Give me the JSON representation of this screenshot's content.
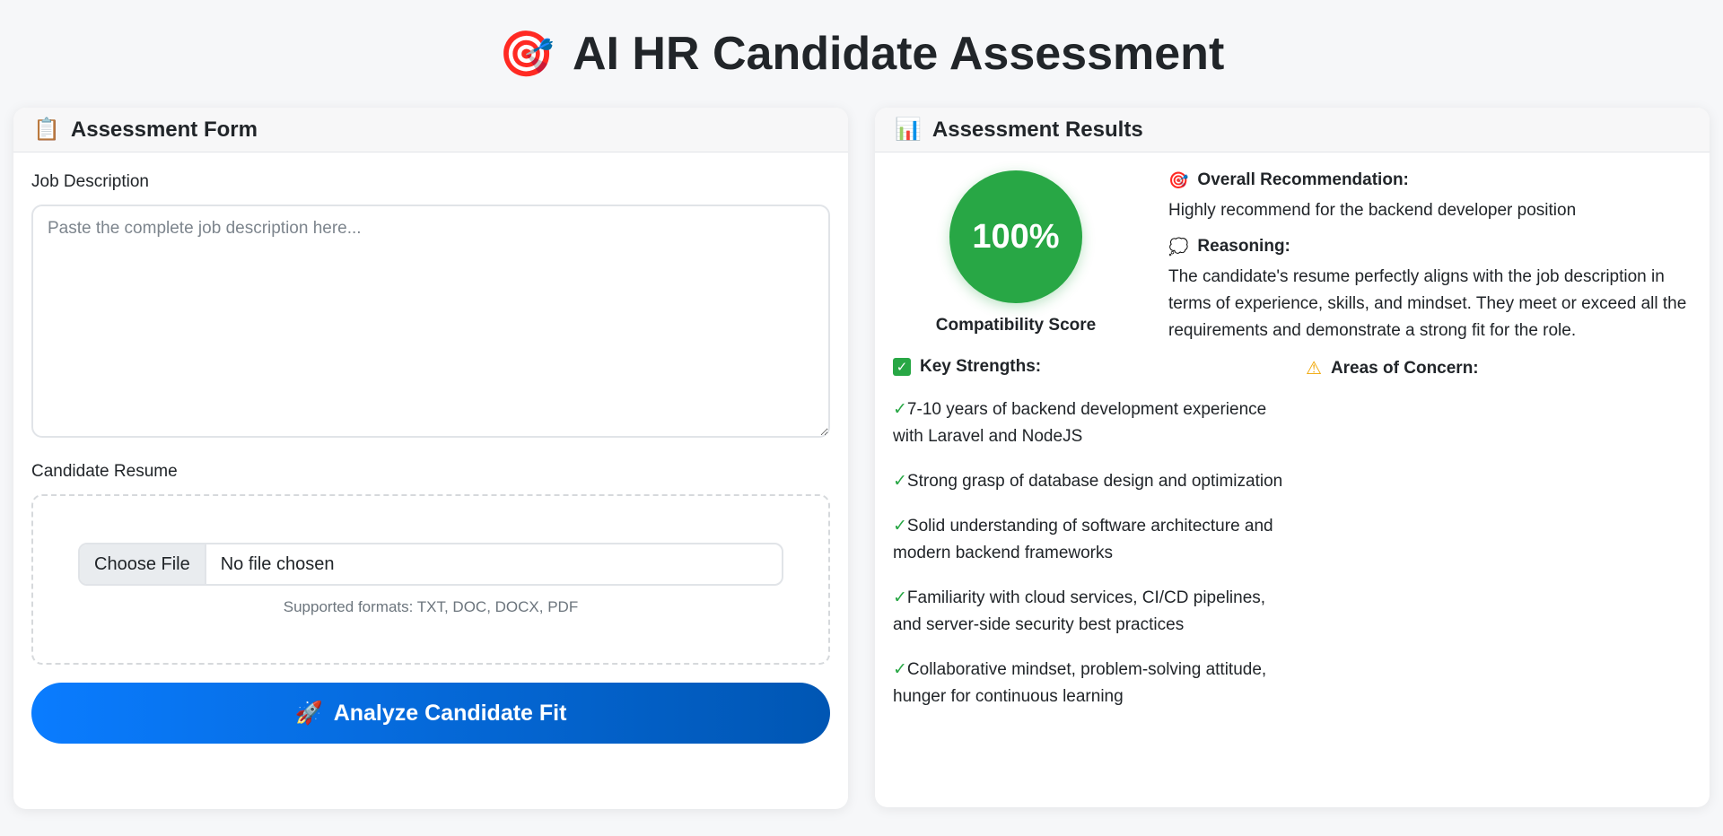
{
  "header": {
    "icon": "target-icon",
    "title": "AI HR Candidate Assessment"
  },
  "form": {
    "header_icon": "clipboard-icon",
    "title": "Assessment Form",
    "job_description_label": "Job Description",
    "job_description_placeholder": "Paste the complete job description here...",
    "job_description_value": "",
    "resume_label": "Candidate Resume",
    "choose_file_label": "Choose File",
    "file_status": "No file chosen",
    "supported_formats": "Supported formats: TXT, DOC, DOCX, PDF",
    "analyze_icon": "rocket-icon",
    "analyze_label": "Analyze Candidate Fit"
  },
  "results": {
    "header_icon": "bar-chart-icon",
    "title": "Assessment Results",
    "score": "100%",
    "score_color": "#28a745",
    "score_label": "Compatibility Score",
    "recommendation_icon": "target-icon",
    "recommendation_heading": "Overall Recommendation:",
    "recommendation_text": "Highly recommend for the backend developer position",
    "reasoning_icon": "thought-bubble-icon",
    "reasoning_heading": "Reasoning:",
    "reasoning_text": "The candidate's resume perfectly aligns with the job description in terms of experience, skills, and mindset. They meet or exceed all the requirements and demonstrate a strong fit for the role.",
    "strengths_icon": "check-box-icon",
    "strengths_heading": "Key Strengths:",
    "strengths": [
      "7-10 years of backend development experience with Laravel and NodeJS",
      "Strong grasp of database design and optimization",
      "Solid understanding of software architecture and modern backend frameworks",
      "Familiarity with cloud services, CI/CD pipelines, and server-side security best practices",
      "Collaborative mindset, problem-solving attitude, hunger for continuous learning"
    ],
    "concerns_icon": "warning-icon",
    "concerns_heading": "Areas of Concern:",
    "concerns": []
  },
  "colors": {
    "primary": "#0a7cff",
    "primary_dark": "#0056b3",
    "success": "#28a745",
    "background": "#f6f7f9"
  }
}
